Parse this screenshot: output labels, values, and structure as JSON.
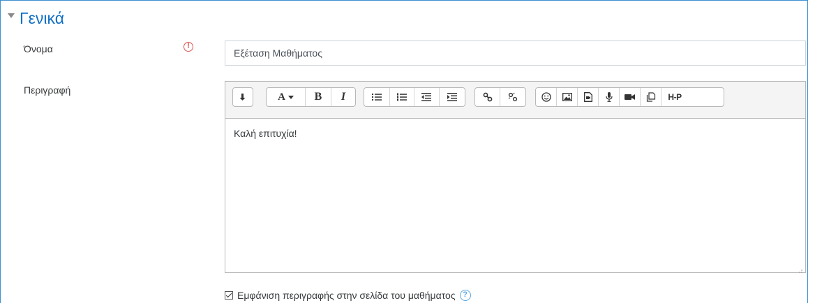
{
  "section": {
    "title": "Γενικά"
  },
  "name_field": {
    "label": "Όνομα",
    "value": "Εξέταση Μαθήματος",
    "required_icon": "!"
  },
  "description_field": {
    "label": "Περιγραφή",
    "content": "Καλή επιτυχία!",
    "toolbar": {
      "font_label": "A",
      "bold_label": "B",
      "italic_label": "I",
      "h5p_label": "H-P"
    }
  },
  "show_description": {
    "label": "Εμφάνιση περιγραφής στην σελίδα του μαθήματος",
    "checked": true,
    "help_icon": "?"
  },
  "colors": {
    "accent": "#0f6fc5",
    "border": "#3d8fd1",
    "required": "#d9534f",
    "help": "#5aa9e0"
  }
}
